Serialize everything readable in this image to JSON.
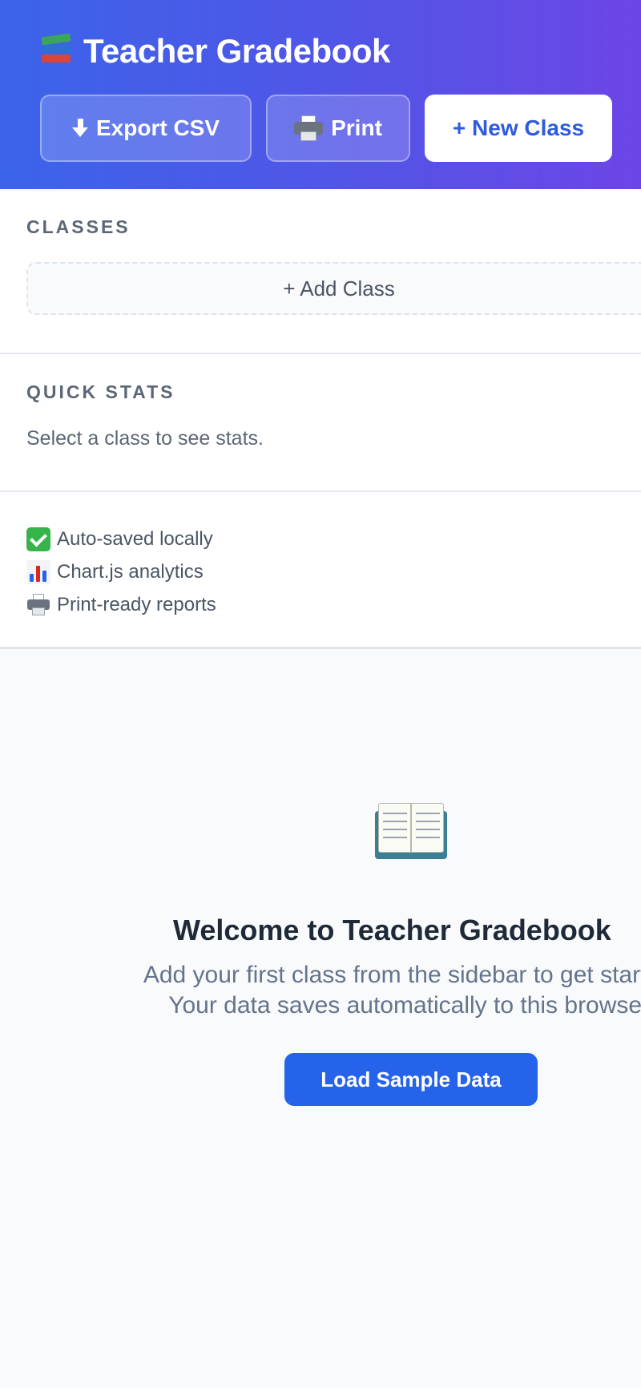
{
  "header": {
    "title": "Teacher Gradebook",
    "brand_icon": "books-icon",
    "buttons": {
      "export_label": "Export CSV",
      "print_label": "Print",
      "new_class_label": "+ New Class"
    }
  },
  "sidebar": {
    "classes": {
      "title": "CLASSES",
      "add_label": "+ Add Class"
    },
    "quick_stats": {
      "title": "QUICK STATS",
      "empty_text": "Select a class to see stats."
    },
    "features": [
      {
        "icon": "check-icon",
        "label": "Auto-saved locally"
      },
      {
        "icon": "bar-chart-icon",
        "label": "Chart.js analytics"
      },
      {
        "icon": "printer-icon",
        "label": "Print-ready reports"
      }
    ]
  },
  "main": {
    "icon": "open-book-icon",
    "title": "Welcome to Teacher Gradebook",
    "line1": "Add your first class from the sidebar to get started.",
    "line2": "Your data saves automatically to this browser.",
    "sample_button_label": "Load Sample Data"
  },
  "colors": {
    "header_start": "#3b64ea",
    "header_end": "#6d45e6",
    "primary": "#2563eb",
    "check_green": "#36b44b"
  }
}
